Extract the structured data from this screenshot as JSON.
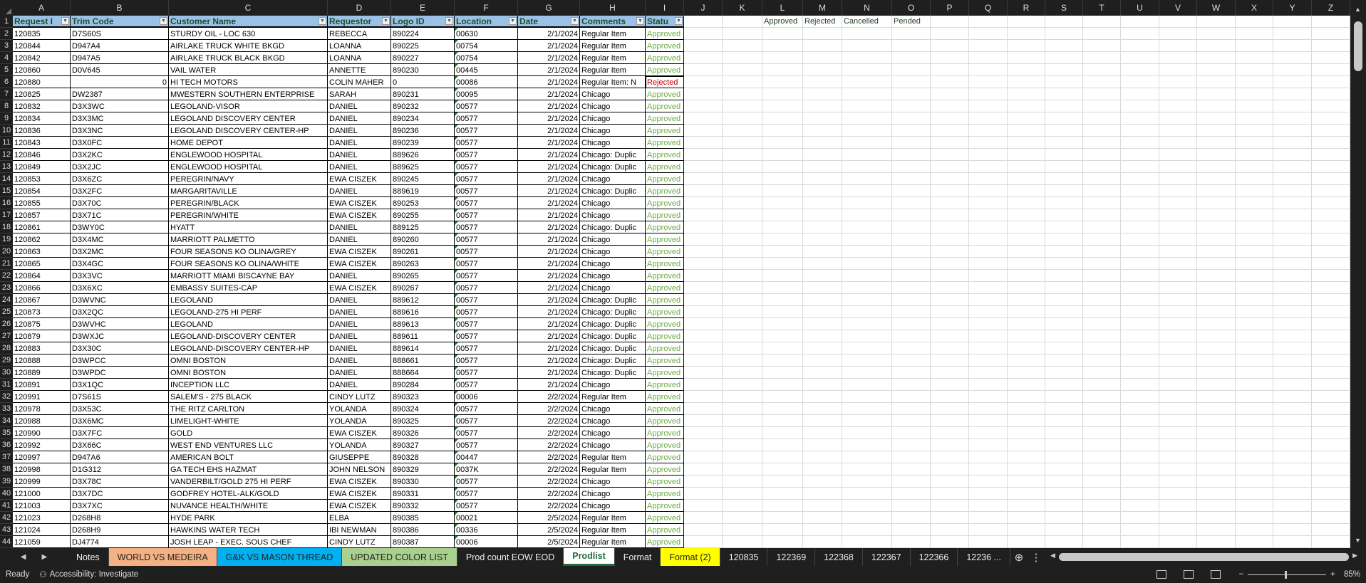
{
  "columns": [
    "A",
    "B",
    "C",
    "D",
    "E",
    "F",
    "G",
    "H",
    "I",
    "J",
    "K",
    "L",
    "M",
    "N",
    "O",
    "P",
    "Q",
    "R",
    "S",
    "T",
    "U",
    "V",
    "W",
    "X",
    "Y",
    "Z"
  ],
  "headers": [
    "Request I",
    "Trim Code",
    "Customer Name",
    "Requestor",
    "Logo ID",
    "Location",
    "Date",
    "Comments",
    "Statu"
  ],
  "extra_row1": {
    "L": "Approved",
    "M": "Rejected",
    "N": "Cancelled",
    "O": "Pended"
  },
  "rows": [
    [
      "120835",
      "D7S60S",
      "STURDY OIL - LOC 630",
      "REBECCA",
      "890224",
      "00630",
      "2/1/2024",
      "Regular Item",
      "Approved"
    ],
    [
      "120844",
      "D947A4",
      "AIRLAKE TRUCK WHITE BKGD",
      "LOANNA",
      "890225",
      "00754",
      "2/1/2024",
      "Regular Item",
      "Approved"
    ],
    [
      "120842",
      "D947A5",
      "AIRLAKE TRUCK BLACK BKGD",
      "LOANNA",
      "890227",
      "00754",
      "2/1/2024",
      "Regular Item",
      "Approved"
    ],
    [
      "120860",
      "D0V645",
      "VAIL WATER",
      "ANNETTE",
      "890230",
      "00445",
      "2/1/2024",
      "Regular Item",
      "Approved"
    ],
    [
      "120880",
      "0",
      "HI TECH MOTORS",
      "COLIN MAHER",
      "0",
      "00086",
      "2/1/2024",
      "Regular Item: N",
      "Rejected"
    ],
    [
      "120825",
      "DW2387",
      "MWESTERN SOUTHERN ENTERPRISE",
      "SARAH",
      "890231",
      "00095",
      "2/1/2024",
      "Chicago",
      "Approved"
    ],
    [
      "120832",
      "D3X3WC",
      "LEGOLAND-VISOR",
      "DANIEL",
      "890232",
      "00577",
      "2/1/2024",
      "Chicago",
      "Approved"
    ],
    [
      "120834",
      "D3X3MC",
      "LEGOLAND DISCOVERY CENTER",
      "DANIEL",
      "890234",
      "00577",
      "2/1/2024",
      "Chicago",
      "Approved"
    ],
    [
      "120836",
      "D3X3NC",
      "LEGOLAND DISCOVERY CENTER-HP",
      "DANIEL",
      "890236",
      "00577",
      "2/1/2024",
      "Chicago",
      "Approved"
    ],
    [
      "120843",
      "D3X0FC",
      "HOME DEPOT",
      "DANIEL",
      "890239",
      "00577",
      "2/1/2024",
      "Chicago",
      "Approved"
    ],
    [
      "120846",
      "D3X2KC",
      "ENGLEWOOD HOSPITAL",
      "DANIEL",
      "889626",
      "00577",
      "2/1/2024",
      "Chicago: Duplic",
      "Approved"
    ],
    [
      "120849",
      "D3X2JC",
      "ENGLEWOOD HOSPITAL",
      "DANIEL",
      "889625",
      "00577",
      "2/1/2024",
      "Chicago: Duplic",
      "Approved"
    ],
    [
      "120853",
      "D3X6ZC",
      "PEREGRIN/NAVY",
      "EWA CISZEK",
      "890245",
      "00577",
      "2/1/2024",
      "Chicago",
      "Approved"
    ],
    [
      "120854",
      "D3X2FC",
      "MARGARITAVILLE",
      "DANIEL",
      "889619",
      "00577",
      "2/1/2024",
      "Chicago: Duplic",
      "Approved"
    ],
    [
      "120855",
      "D3X70C",
      "PEREGRIN/BLACK",
      "EWA CISZEK",
      "890253",
      "00577",
      "2/1/2024",
      "Chicago",
      "Approved"
    ],
    [
      "120857",
      "D3X71C",
      "PEREGRIN/WHITE",
      "EWA CISZEK",
      "890255",
      "00577",
      "2/1/2024",
      "Chicago",
      "Approved"
    ],
    [
      "120861",
      "D3WY0C",
      "HYATT",
      "DANIEL",
      "889125",
      "00577",
      "2/1/2024",
      "Chicago: Duplic",
      "Approved"
    ],
    [
      "120862",
      "D3X4MC",
      "MARRIOTT PALMETTO",
      "DANIEL",
      "890260",
      "00577",
      "2/1/2024",
      "Chicago",
      "Approved"
    ],
    [
      "120863",
      "D3X2MC",
      "FOUR SEASONS KO OLINA/GREY",
      "EWA CISZEK",
      "890261",
      "00577",
      "2/1/2024",
      "Chicago",
      "Approved"
    ],
    [
      "120865",
      "D3X4GC",
      "FOUR SEASONS KO OLINA/WHITE",
      "EWA CISZEK",
      "890263",
      "00577",
      "2/1/2024",
      "Chicago",
      "Approved"
    ],
    [
      "120864",
      "D3X3VC",
      "MARRIOTT MIAMI BISCAYNE BAY",
      "DANIEL",
      "890265",
      "00577",
      "2/1/2024",
      "Chicago",
      "Approved"
    ],
    [
      "120866",
      "D3X6XC",
      "EMBASSY SUITES-CAP",
      "EWA CISZEK",
      "890267",
      "00577",
      "2/1/2024",
      "Chicago",
      "Approved"
    ],
    [
      "120867",
      "D3WVNC",
      "LEGOLAND",
      "DANIEL",
      "889612",
      "00577",
      "2/1/2024",
      "Chicago: Duplic",
      "Approved"
    ],
    [
      "120873",
      "D3X2QC",
      "LEGOLAND-275 HI PERF",
      "DANIEL",
      "889616",
      "00577",
      "2/1/2024",
      "Chicago: Duplic",
      "Approved"
    ],
    [
      "120875",
      "D3WVHC",
      "LEGOLAND",
      "DANIEL",
      "889613",
      "00577",
      "2/1/2024",
      "Chicago: Duplic",
      "Approved"
    ],
    [
      "120879",
      "D3WXJC",
      "LEGOLAND-DISCOVERY CENTER",
      "DANIEL",
      "889611",
      "00577",
      "2/1/2024",
      "Chicago: Duplic",
      "Approved"
    ],
    [
      "120883",
      "D3X30C",
      "LEGOLAND-DISCOVERY CENTER-HP",
      "DANIEL",
      "889614",
      "00577",
      "2/1/2024",
      "Chicago: Duplic",
      "Approved"
    ],
    [
      "120888",
      "D3WPCC",
      "OMNI BOSTON",
      "DANIEL",
      "888661",
      "00577",
      "2/1/2024",
      "Chicago: Duplic",
      "Approved"
    ],
    [
      "120889",
      "D3WPDC",
      "OMNI BOSTON",
      "DANIEL",
      "888664",
      "00577",
      "2/1/2024",
      "Chicago: Duplic",
      "Approved"
    ],
    [
      "120891",
      "D3X1QC",
      "INCEPTION LLC",
      "DANIEL",
      "890284",
      "00577",
      "2/1/2024",
      "Chicago",
      "Approved"
    ],
    [
      "120991",
      "D7S61S",
      "SALEM'S - 275 BLACK",
      "CINDY LUTZ",
      "890323",
      "00006",
      "2/2/2024",
      "Regular Item",
      "Approved"
    ],
    [
      "120978",
      "D3X53C",
      "THE RITZ CARLTON",
      "YOLANDA",
      "890324",
      "00577",
      "2/2/2024",
      "Chicago",
      "Approved"
    ],
    [
      "120988",
      "D3X6MC",
      "LIMELIGHT-WHITE",
      "YOLANDA",
      "890325",
      "00577",
      "2/2/2024",
      "Chicago",
      "Approved"
    ],
    [
      "120990",
      "D3X7FC",
      "GOLD",
      "EWA CISZEK",
      "890326",
      "00577",
      "2/2/2024",
      "Chicago",
      "Approved"
    ],
    [
      "120992",
      "D3X66C",
      "WEST END VENTURES LLC",
      "YOLANDA",
      "890327",
      "00577",
      "2/2/2024",
      "Chicago",
      "Approved"
    ],
    [
      "120997",
      "D947A6",
      "AMERICAN BOLT",
      "GIUSEPPE",
      "890328",
      "00447",
      "2/2/2024",
      "Regular Item",
      "Approved"
    ],
    [
      "120998",
      "D1G312",
      "GA TECH EHS HAZMAT",
      "JOHN NELSON",
      "890329",
      "0037K",
      "2/2/2024",
      "Regular Item",
      "Approved"
    ],
    [
      "120999",
      "D3X78C",
      "VANDERBILT/GOLD 275 HI PERF",
      "EWA CISZEK",
      "890330",
      "00577",
      "2/2/2024",
      "Chicago",
      "Approved"
    ],
    [
      "121000",
      "D3X7DC",
      "GODFREY HOTEL-ALK/GOLD",
      "EWA CISZEK",
      "890331",
      "00577",
      "2/2/2024",
      "Chicago",
      "Approved"
    ],
    [
      "121003",
      "D3X7XC",
      "NUVANCE HEALTH/WHITE",
      "EWA CISZEK",
      "890332",
      "00577",
      "2/2/2024",
      "Chicago",
      "Approved"
    ],
    [
      "121023",
      "D268H8",
      "HYDE PARK",
      "ELBA",
      "890385",
      "00021",
      "2/5/2024",
      "Regular Item",
      "Approved"
    ],
    [
      "121024",
      "D268H9",
      "HAWKINS WATER TECH",
      "IBI NEWMAN",
      "890386",
      "00336",
      "2/5/2024",
      "Regular Item",
      "Approved"
    ],
    [
      "121059",
      "DJ4774",
      "JOSH LEAP - EXEC. SOUS CHEF",
      "CINDY LUTZ",
      "890387",
      "00006",
      "2/5/2024",
      "Regular Item",
      "Approved"
    ]
  ],
  "tabs": [
    {
      "label": "Notes",
      "color": ""
    },
    {
      "label": "WORLD VS MEDEIRA",
      "color": "#f4b183"
    },
    {
      "label": "G&K VS MASON THREAD",
      "color": "#00b0f0"
    },
    {
      "label": "UPDATED COLOR LIST",
      "color": "#a9d08e"
    },
    {
      "label": "Prod count EOW EOD",
      "color": ""
    },
    {
      "label": "Prodlist",
      "color": "",
      "active": true
    },
    {
      "label": "Format",
      "color": ""
    },
    {
      "label": "Format (2)",
      "color": "#ffff00"
    },
    {
      "label": "120835",
      "color": ""
    },
    {
      "label": "122369",
      "color": ""
    },
    {
      "label": "122368",
      "color": ""
    },
    {
      "label": "122367",
      "color": ""
    },
    {
      "label": "122366",
      "color": ""
    },
    {
      "label": "12236 ...",
      "color": ""
    }
  ],
  "status": {
    "ready": "Ready",
    "accessibility": "Accessibility: Investigate",
    "zoom": "85%"
  },
  "colors": {
    "approved": "#70ad47",
    "rejected": "#c00000",
    "header_fill": "#9bc2e6"
  }
}
